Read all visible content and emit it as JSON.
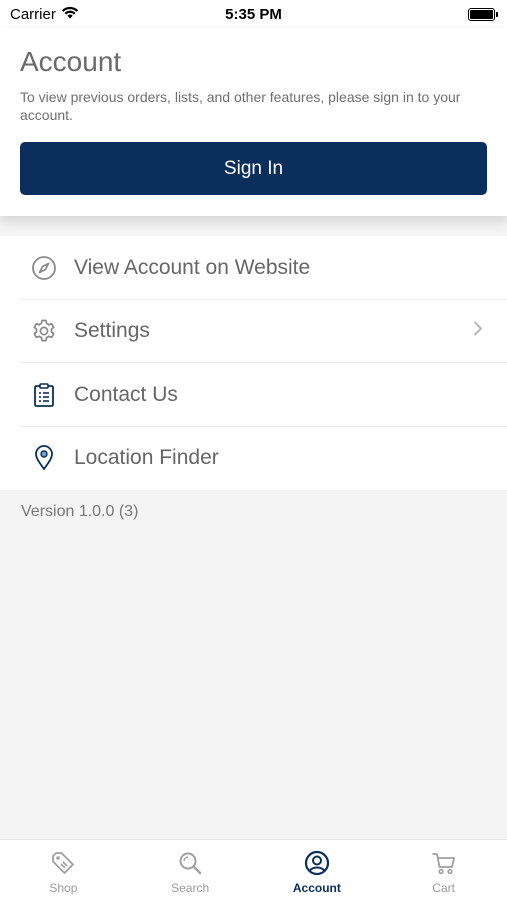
{
  "status_bar": {
    "carrier": "Carrier",
    "time": "5:35 PM",
    "wifi_icon": "wifi-icon",
    "battery_icon": "battery-icon"
  },
  "header": {
    "title": "Account",
    "subtitle": "To view previous orders, lists, and other features, please sign in to your account.",
    "sign_in_label": "Sign In"
  },
  "menu": {
    "items": [
      {
        "label": "View Account on Website",
        "icon": "compass-icon"
      },
      {
        "label": "Settings",
        "icon": "gear-icon",
        "chevron": "chevron-right-icon"
      },
      {
        "label": "Contact Us",
        "icon": "clipboard-icon"
      },
      {
        "label": "Location Finder",
        "icon": "location-pin-icon"
      }
    ]
  },
  "version": "Version 1.0.0 (3)",
  "tab_bar": {
    "tabs": [
      {
        "label": "Shop",
        "icon": "tag-icon",
        "active": false
      },
      {
        "label": "Search",
        "icon": "search-icon",
        "active": false
      },
      {
        "label": "Account",
        "icon": "account-icon",
        "active": true
      },
      {
        "label": "Cart",
        "icon": "cart-icon",
        "active": false
      }
    ]
  },
  "colors": {
    "brand_navy": "#0a2f5c",
    "icon_gray": "#8a8a8a",
    "background": "#f4f4f4"
  }
}
